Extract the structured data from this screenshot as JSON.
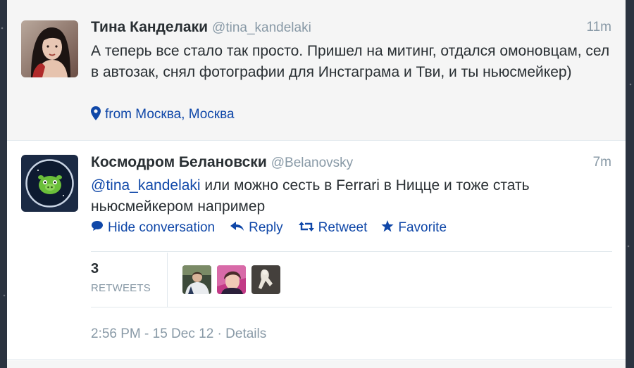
{
  "tweets": [
    {
      "fullname": "Тина Канделаки",
      "username": "@tina_kandelaki",
      "time": "11m",
      "text": "А теперь все стало так просто. Пришел на митинг, отдался омоновцам, сел в автозак, снял фотографии для Инстаграма и Тви, и ты ньюсмейкер)",
      "location": "from Москва, Москва",
      "avatar_icon": "portrait-woman"
    },
    {
      "fullname": "Космодром Белановски",
      "username": "@Belanovsky",
      "time": "7m",
      "mention": "@tina_kandelaki",
      "text": " или можно сесть в Ferrari в Ницце и тоже стать ньюсмейкером например",
      "avatar_icon": "green-pig-in-circle",
      "actions": {
        "hide_conversation": "Hide conversation",
        "reply": "Reply",
        "retweet": "Retweet",
        "favorite": "Favorite"
      },
      "retweet_count": "3",
      "retweets_label": "RETWEETS",
      "timestamp": "2:56 PM - 15 Dec 12",
      "separator": " · ",
      "details_label": "Details"
    }
  ],
  "colors": {
    "link": "#0f47a8",
    "text": "#292f33",
    "muted": "#8899a6",
    "page_bg": "#2b3340"
  }
}
